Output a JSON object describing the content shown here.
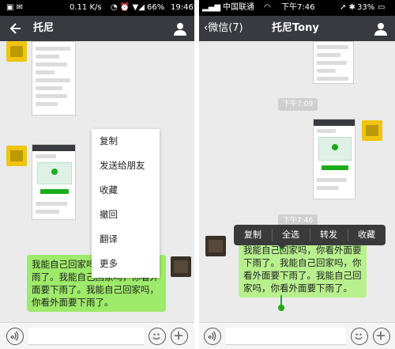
{
  "left": {
    "status": {
      "carrier_icons": "▣ ✉",
      "speed": "0.11 K/s",
      "battery": "66%",
      "time": "19:46"
    },
    "header": {
      "title": "托尼"
    },
    "menu": [
      "复制",
      "发送给朋友",
      "收藏",
      "撤回",
      "翻译",
      "更多"
    ],
    "message": "我能自己回家吗，你看外面要下雨了。我能自己回家吗，你看外面要下雨了。我能自己回家吗，你看外面要下雨了。"
  },
  "right": {
    "status": {
      "carrier": "中国联通",
      "time": "下午7:46",
      "battery": "33%"
    },
    "header": {
      "back_label": "微信(7)",
      "title": "托尼Tony"
    },
    "timestamps": [
      "下午7:09",
      "下午7:46"
    ],
    "context_menu": [
      "复制",
      "全选",
      "转发",
      "收藏"
    ],
    "message": "我能自己回家吗，你看外面要下雨了。我能自己回家吗，你看外面要下雨了。我能自己回家吗，你看外面要下雨了。"
  },
  "colors": {
    "titlebar": "#393a3f",
    "bubble": "#9eea6a",
    "accent": "#1aad19"
  }
}
